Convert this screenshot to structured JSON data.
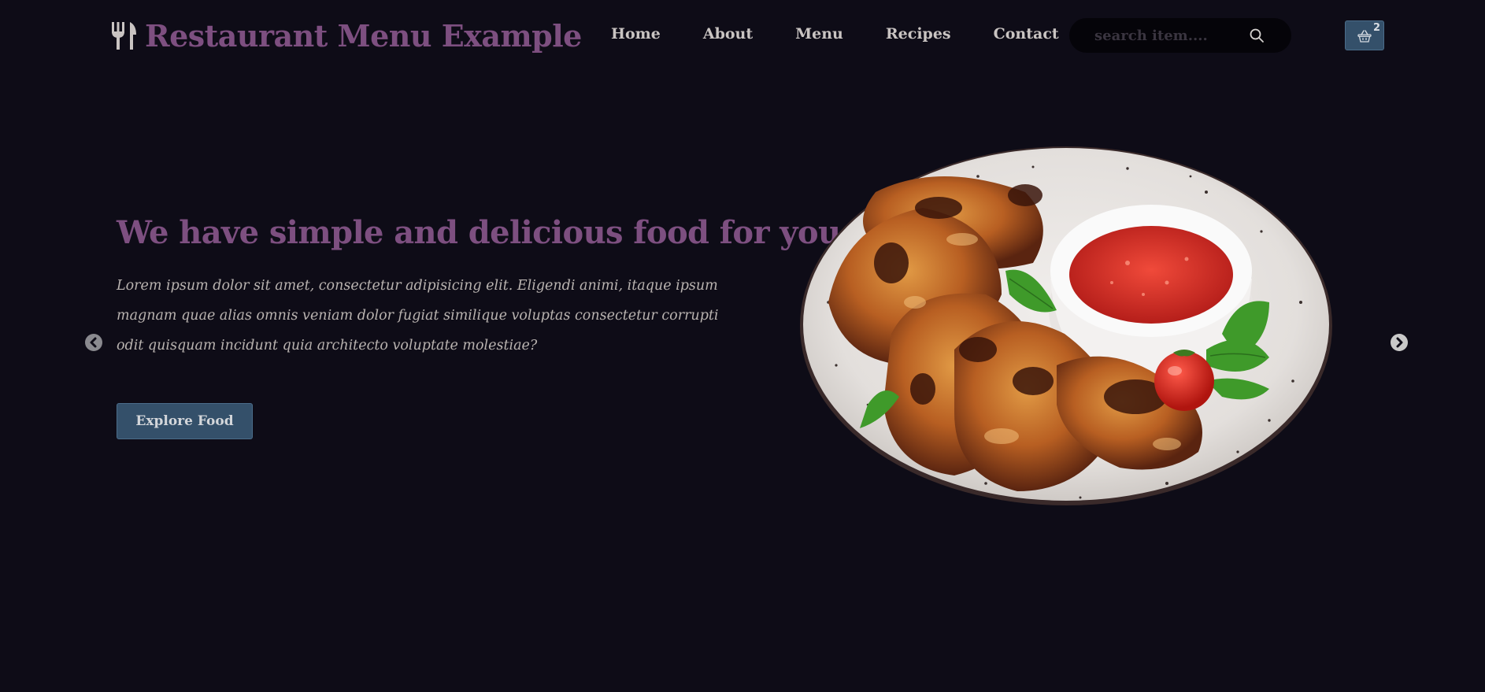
{
  "brand": {
    "title": "Restaurant Menu Example",
    "icon": "fork-knife-icon",
    "color": "#7d4f80"
  },
  "nav": {
    "items": [
      {
        "label": "Home"
      },
      {
        "label": "About"
      },
      {
        "label": "Menu"
      },
      {
        "label": "Recipes"
      },
      {
        "label": "Contact"
      }
    ]
  },
  "search": {
    "placeholder": "search item....",
    "value": "",
    "icon": "search-icon"
  },
  "cart": {
    "icon": "basket-icon",
    "count": "2"
  },
  "hero": {
    "title": "We have simple and delicious food for you",
    "text": "Lorem ipsum dolor sit amet, consectetur adipisicing elit. Eligendi animi, itaque ipsum magnam quae alias omnis veniam dolor fugiat similique voluptas consectetur corrupti odit quisquam incidunt quia architecto voluptate molestiae?",
    "button_label": "Explore Food",
    "image": "grilled-chicken-wings-plate-image"
  },
  "carousel": {
    "prev_icon": "chevron-left-icon",
    "next_icon": "chevron-right-icon"
  },
  "colors": {
    "background": "#0e0c17",
    "accent": "#7d4f80",
    "button": "#34506a",
    "text": "#c9c4c2"
  }
}
